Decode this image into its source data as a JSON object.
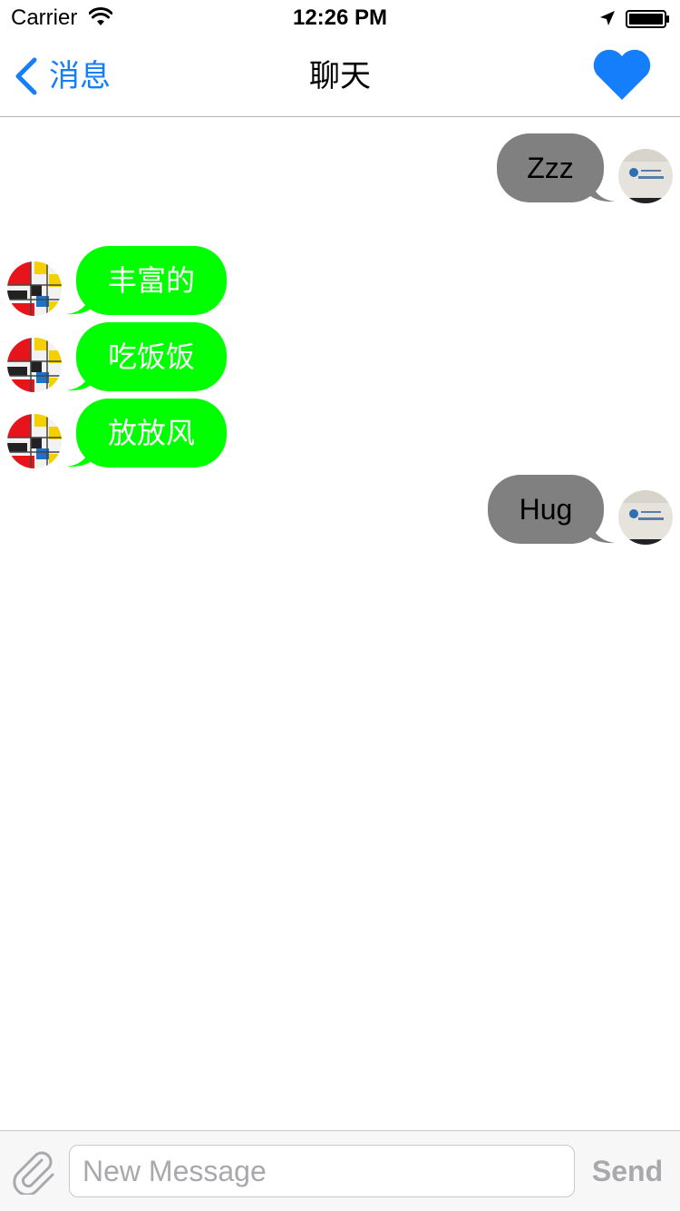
{
  "status_bar": {
    "carrier": "Carrier",
    "time": "12:26 PM",
    "icons": [
      "wifi-icon",
      "location-arrow-icon",
      "battery-icon"
    ]
  },
  "nav": {
    "back_label": "消息",
    "title": "聊天",
    "right_icon": "heart-icon"
  },
  "messages": [
    {
      "direction": "outgoing",
      "text": "Zzz"
    },
    {
      "direction": "incoming",
      "text": "丰富的"
    },
    {
      "direction": "incoming",
      "text": "吃饭饭"
    },
    {
      "direction": "incoming",
      "text": "放放风"
    },
    {
      "direction": "outgoing",
      "text": "Hug"
    }
  ],
  "input_bar": {
    "attach_icon": "paperclip-icon",
    "placeholder": "New Message",
    "value": "",
    "send_label": "Send"
  },
  "colors": {
    "accent": "#157efb",
    "outgoing_bubble": "#808080",
    "incoming_bubble": "#00ff00",
    "incoming_text": "#ffffff",
    "outgoing_text": "#000000",
    "disabled_text": "#a8a8ad"
  }
}
